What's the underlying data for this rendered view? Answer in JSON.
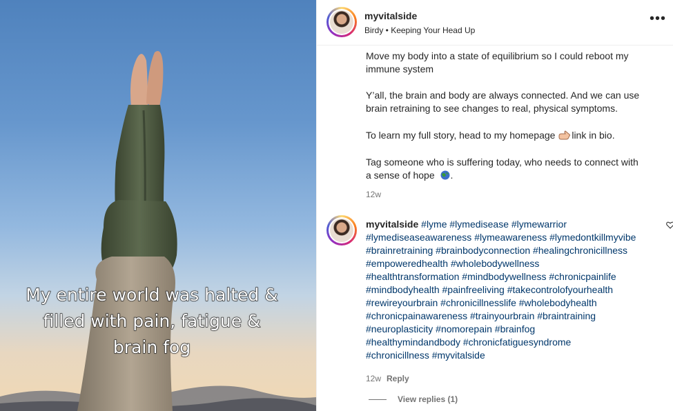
{
  "media": {
    "overlay_lines": [
      "My entire world was halted &",
      "filled with pain, fatigue &",
      "brain fog"
    ]
  },
  "post": {
    "username": "myvitalside",
    "audio": "Birdy • Keeping Your Head Up",
    "caption": [
      "Move my body into a state of equilibrium so I could reboot my",
      "immune system",
      "Y’all, the brain and body are always connected. And we can use",
      "brain retraining to see changes to real, physical symptoms.",
      "To learn my full story, head to my homepage",
      "link in bio.",
      "Tag someone who is suffering today, who needs to connect with",
      "a sense of hope",
      "."
    ],
    "time": "12w"
  },
  "comment": {
    "username": "myvitalside",
    "hashtag_lines": [
      "#lyme #lymedisease #lymewarrior",
      "#lymediseaseawareness #lymeawareness #lymedontkillmyvibe",
      "#brainretraining #brainbodyconnection #healingchronicillness",
      "#empoweredhealth #wholebodywellness",
      "#healthtransformation #mindbodywellness #chronicpainlife",
      "#mindbodyhealth #painfreeliving #takecontrolofyourhealth",
      "#rewireyourbrain #chronicillnesslife #wholebodyhealth",
      "#chronicpainawareness #trainyourbrain #braintraining",
      "#neuroplasticity #nomorepain #brainfog",
      "#healthymindandbody #chronicfatiguesyndrome",
      "#chronicillness #myvitalside"
    ],
    "time": "12w",
    "reply_label": "Reply",
    "view_replies": "View replies (1)"
  },
  "icons": {
    "more": "more-options-icon",
    "heart": "heart-icon",
    "pointing_hand": "pointing-hand-emoji",
    "globe": "globe-emoji"
  }
}
